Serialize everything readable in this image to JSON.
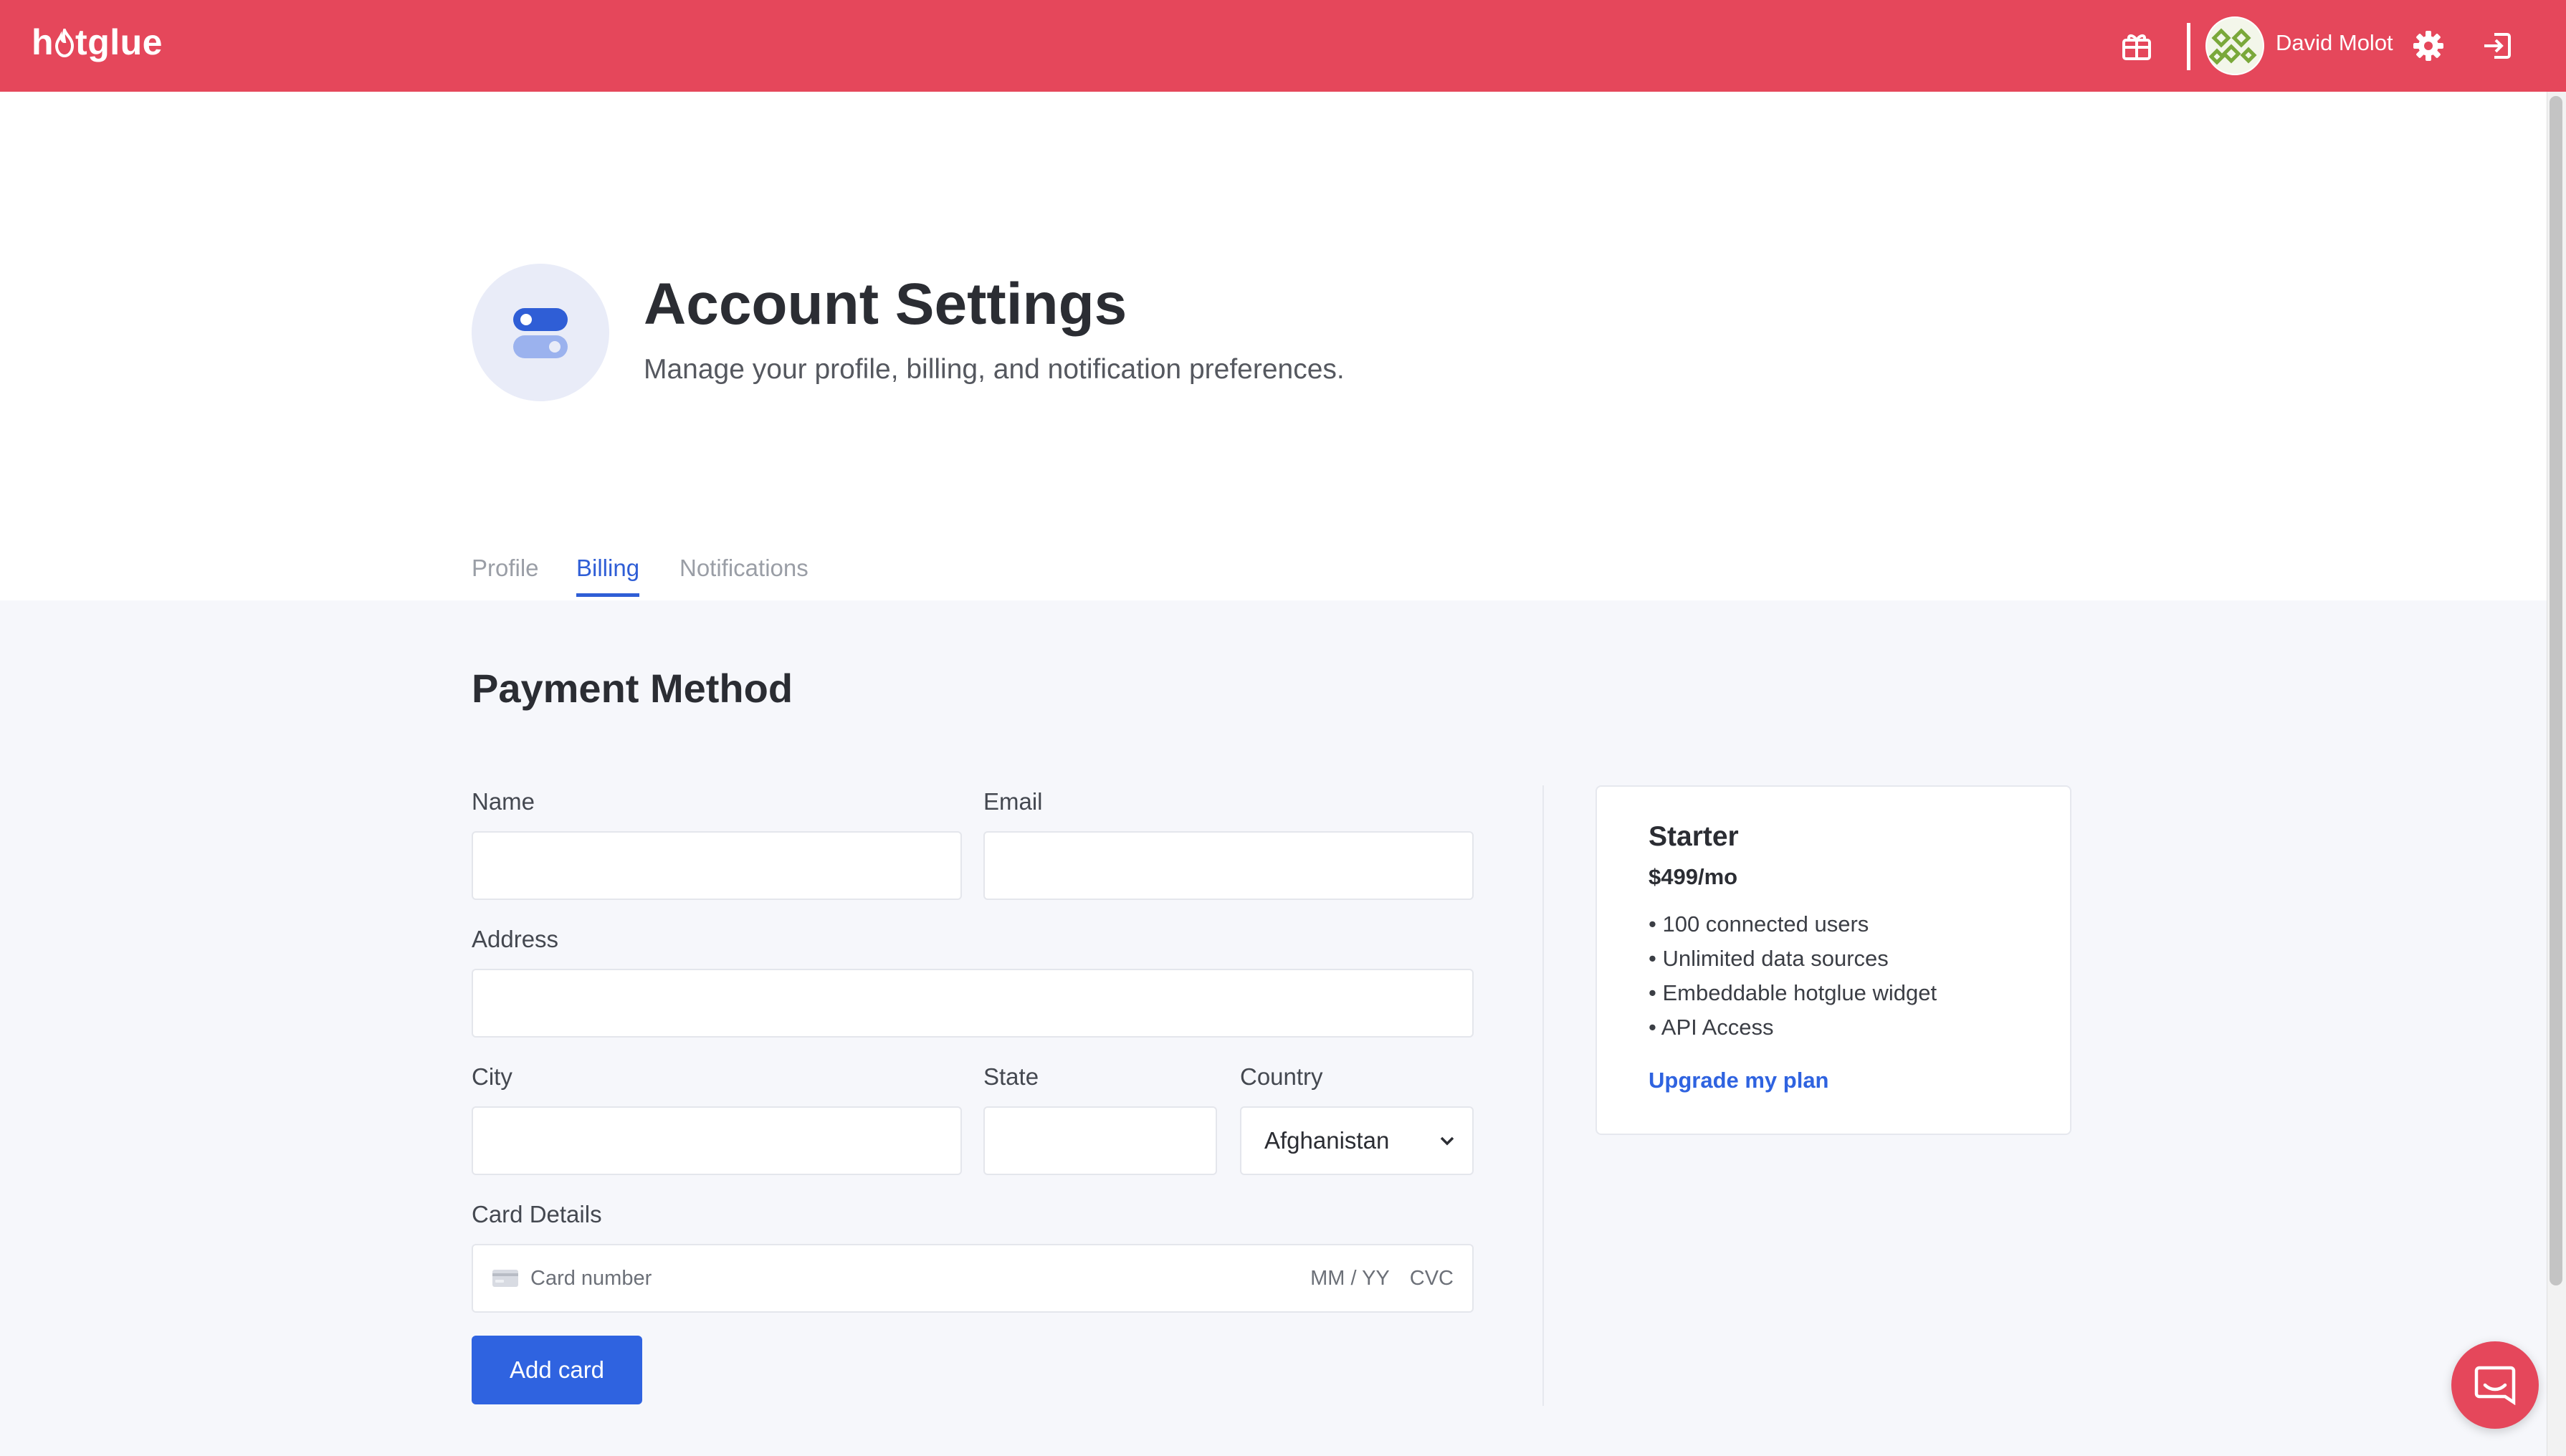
{
  "topbar": {
    "logo_text": "hotglue",
    "logo_prefix": "h",
    "logo_suffix": "tglue",
    "user_name": "David Molot",
    "icons": [
      "gift-icon",
      "gear-icon",
      "logout-icon"
    ],
    "bg_color": "#e5475b"
  },
  "header": {
    "title": "Account Settings",
    "subtitle": "Manage your profile, billing, and notification preferences."
  },
  "tabs": [
    {
      "label": "Profile",
      "active": false
    },
    {
      "label": "Billing",
      "active": true
    },
    {
      "label": "Notifications",
      "active": false
    }
  ],
  "payment": {
    "section_title": "Payment Method",
    "fields": {
      "name_label": "Name",
      "name_value": "",
      "email_label": "Email",
      "email_value": "",
      "address_label": "Address",
      "address_value": "",
      "city_label": "City",
      "city_value": "",
      "state_label": "State",
      "state_value": "",
      "country_label": "Country",
      "country_value": "Afghanistan",
      "card_label": "Card Details",
      "card_number_placeholder": "Card number",
      "card_exp_placeholder": "MM / YY",
      "card_cvc_placeholder": "CVC"
    },
    "add_card_label": "Add card"
  },
  "plan": {
    "name": "Starter",
    "price": "$499/mo",
    "features": [
      "100 connected users",
      "Unlimited data sources",
      "Embeddable hotglue widget",
      "API Access"
    ],
    "upgrade_label": "Upgrade my plan"
  },
  "colors": {
    "accent": "#2f63e0",
    "brand": "#e5475b"
  }
}
